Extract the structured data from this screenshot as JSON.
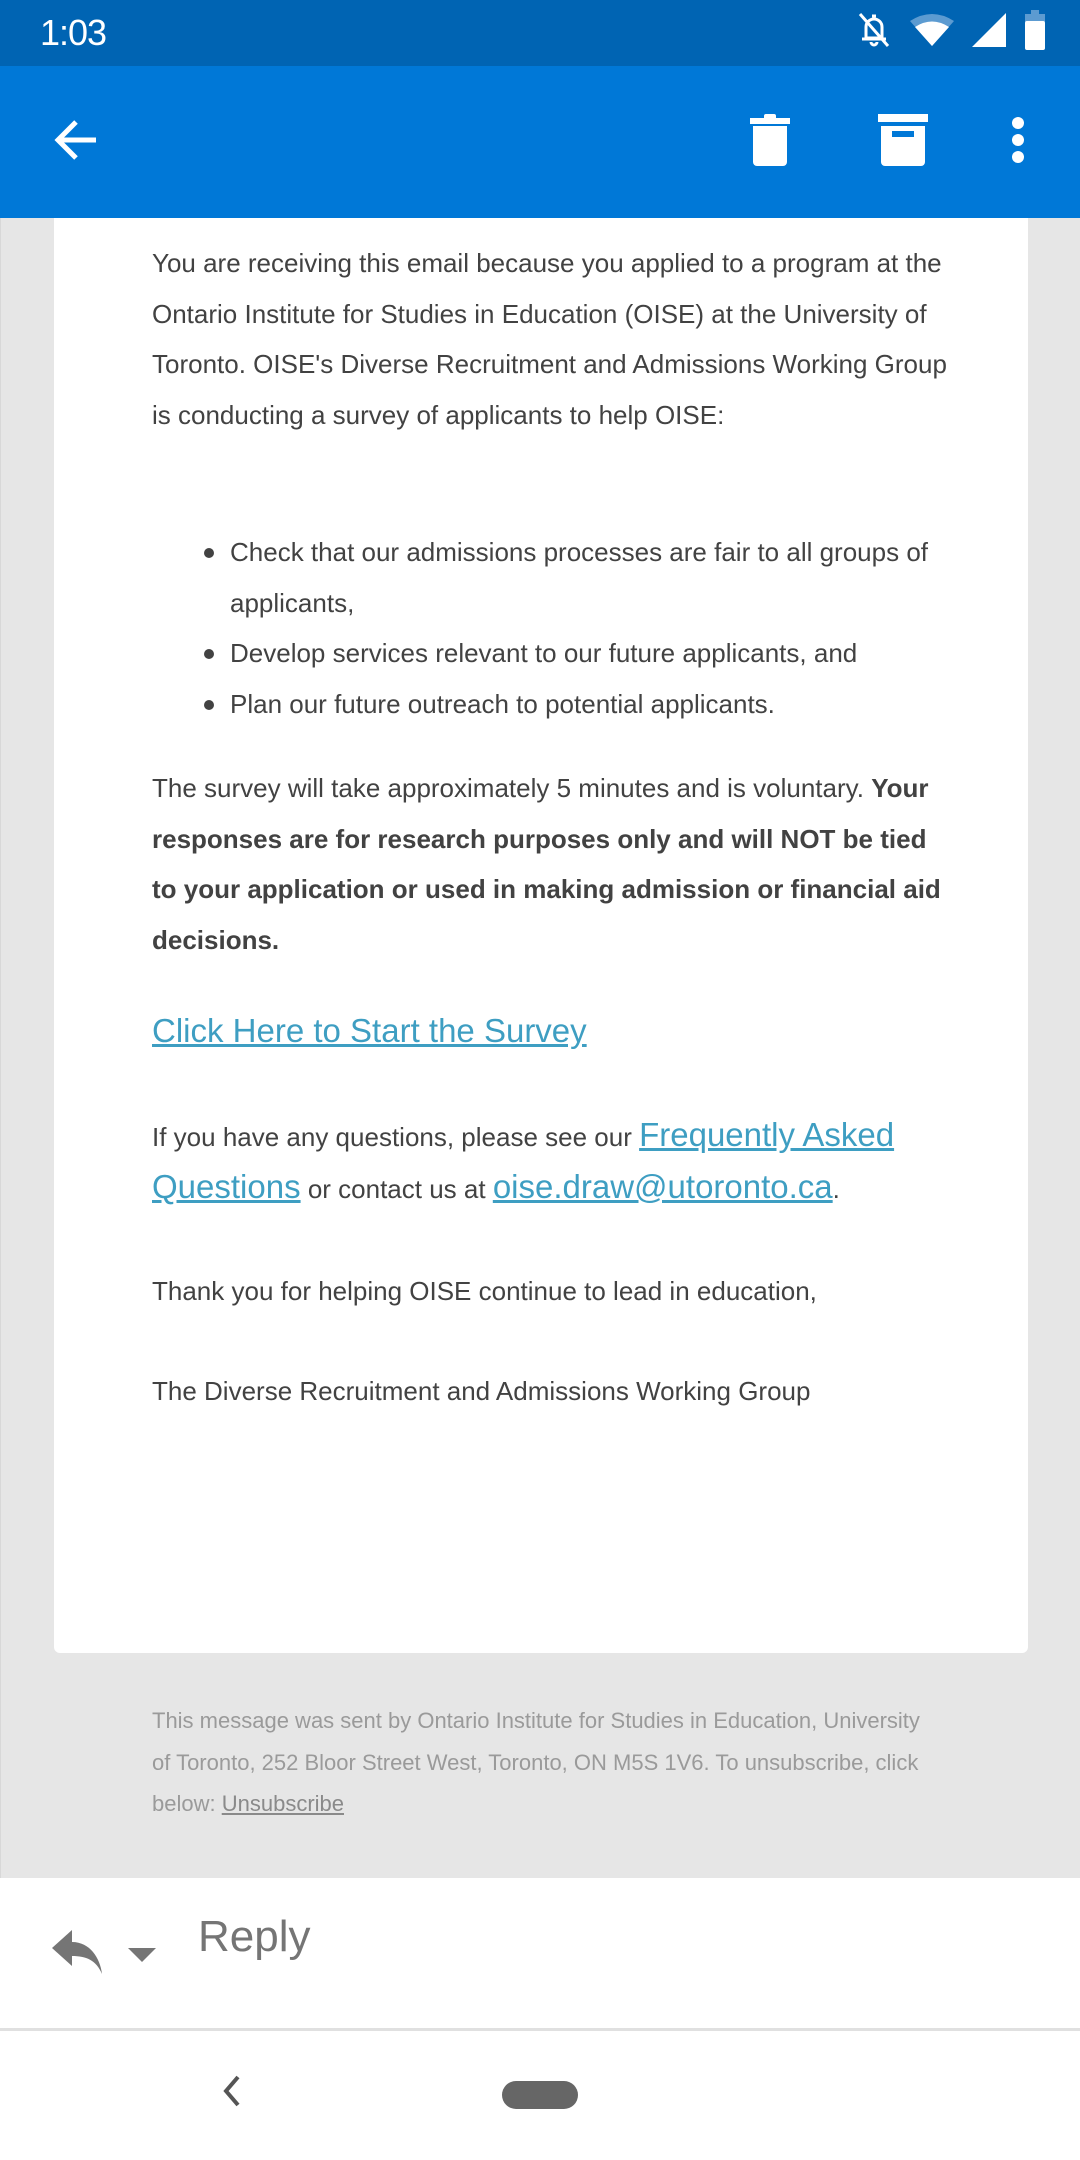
{
  "status_bar": {
    "time": "1:03",
    "icons": [
      "notifications-off-icon",
      "wifi-icon",
      "cell-signal-icon",
      "battery-icon"
    ]
  },
  "app_bar": {
    "actions": [
      {
        "name": "back",
        "icon": "arrow-left-icon"
      },
      {
        "name": "delete",
        "icon": "trash-icon"
      },
      {
        "name": "archive",
        "icon": "archive-icon"
      },
      {
        "name": "more",
        "icon": "more-vert-icon"
      }
    ]
  },
  "colors": {
    "status_bar": "#0064B3",
    "app_bar": "#0078D7",
    "link": "#3E9EC2",
    "body_text": "#424242",
    "background": "#E6E6E6"
  },
  "email": {
    "intro": "You are receiving this email because you applied to a program at the Ontario Institute for Studies in Education (OISE) at the University of Toronto. OISE's Diverse Recruitment and Admissions Working Group is conducting a survey of applicants to help OISE:",
    "bullets": [
      "Check that our admissions processes are fair to all groups of applicants,",
      "Develop services relevant to our future applicants, and",
      "Plan our future outreach to potential applicants."
    ],
    "survey_time": "The survey will take approximately 5 minutes and is voluntary.",
    "disclaimer_bold": "Your responses are for research purposes only and will NOT be tied to your application or used in making admission or financial aid decisions.",
    "survey_link": "Click Here to Start the Survey",
    "faq_prefix": "If you have any questions, please see our ",
    "faq_link": "Frequently Asked Questions",
    "faq_middle": " or contact us at ",
    "email_link": "oise.draw@utoronto.ca",
    "faq_suffix": ".",
    "thanks": "Thank you for helping OISE continue to lead in education,",
    "signature": "The Diverse Recruitment and Admissions Working Group"
  },
  "footer": {
    "text": "This message was sent by Ontario Institute for Studies in Education, University of Toronto, 252 Bloor Street West, Toronto, ON M5S 1V6. To unsubscribe, click below: ",
    "unsubscribe": "Unsubscribe"
  },
  "reply_bar": {
    "label": "Reply"
  }
}
